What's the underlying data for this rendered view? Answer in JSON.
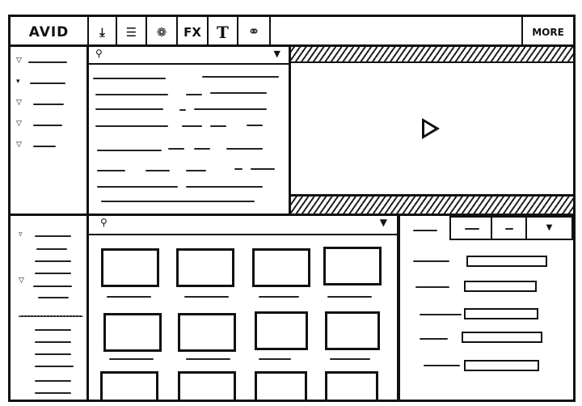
{
  "header": {
    "logo": "AVID",
    "tools": [
      {
        "icon": "download-icon",
        "glyph": "⤓"
      },
      {
        "icon": "list-icon",
        "glyph": "☰"
      },
      {
        "icon": "color-circles-icon",
        "glyph": "❁"
      },
      {
        "icon": "fx-icon",
        "glyph": "FX"
      },
      {
        "icon": "text-icon",
        "glyph": "T"
      },
      {
        "icon": "link-icon",
        "glyph": "⚭"
      }
    ],
    "more_label": "MORE"
  },
  "viewer": {
    "play_icon": "play-icon"
  },
  "colors": {
    "ink": "#111111",
    "paper": "#ffffff"
  }
}
